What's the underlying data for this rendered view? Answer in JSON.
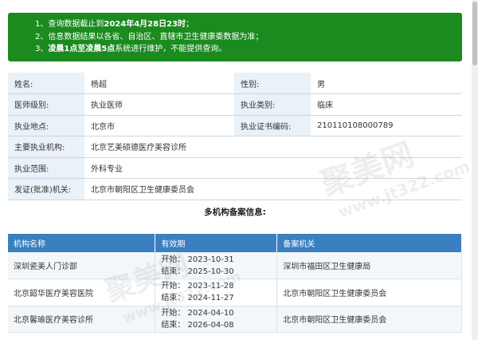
{
  "notice": {
    "line1_prefix": "1、查询数据截止到",
    "line1_bold": "2024年4月28日23时",
    "line1_suffix": "；",
    "line2": "2、信息数据结果以各省、自治区、直辖市卫生健康委数据为准；",
    "line3_prefix": "3、",
    "line3_bold": "凌晨1点至凌晨5点",
    "line3_suffix": "系统进行维护，不能提供查询。"
  },
  "info": {
    "name_label": "姓名:",
    "name_value": "杨超",
    "gender_label": "性别:",
    "gender_value": "男",
    "level_label": "医师级别:",
    "level_value": "执业医师",
    "category_label": "执业类别:",
    "category_value": "临床",
    "location_label": "执业地点:",
    "location_value": "北京市",
    "cert_label": "执业证书编码:",
    "cert_value": "210110108000789",
    "org_label": "主要执业机构:",
    "org_value": "北京艺美硕德医疗美容诊所",
    "scope_label": "执业范围:",
    "scope_value": "外科专业",
    "authority_label": "发证(批准)机关:",
    "authority_value": "北京市朝阳区卫生健康委员会"
  },
  "multi_title": "多机构备案信息:",
  "registrations": {
    "headers": [
      "机构名称",
      "有效期",
      "备案机关"
    ],
    "rows": [
      {
        "org": "深圳瓷美人门诊部",
        "start": "开始：  2023-10-31",
        "end": "结束：  2025-10-30",
        "authority": "深圳市福田区卫生健康局"
      },
      {
        "org": "北京韶华医疗美容医院",
        "start": "开始：  2023-11-28",
        "end": "结束：  2024-11-27",
        "authority": "北京市朝阳区卫生健康委员会"
      },
      {
        "org": "北京馨瑜医疗美容诊所",
        "start": "开始：  2024-04-10",
        "end": "结束：  2026-04-08",
        "authority": "北京市朝阳区卫生健康委员会"
      }
    ]
  },
  "watermark": {
    "brand": "聚美网",
    "url": "www.jt322.com"
  },
  "colors": {
    "notice_bg": "#1b8a1f",
    "header_bg": "#3a7fc0",
    "label_bg": "#eaf1f7"
  }
}
